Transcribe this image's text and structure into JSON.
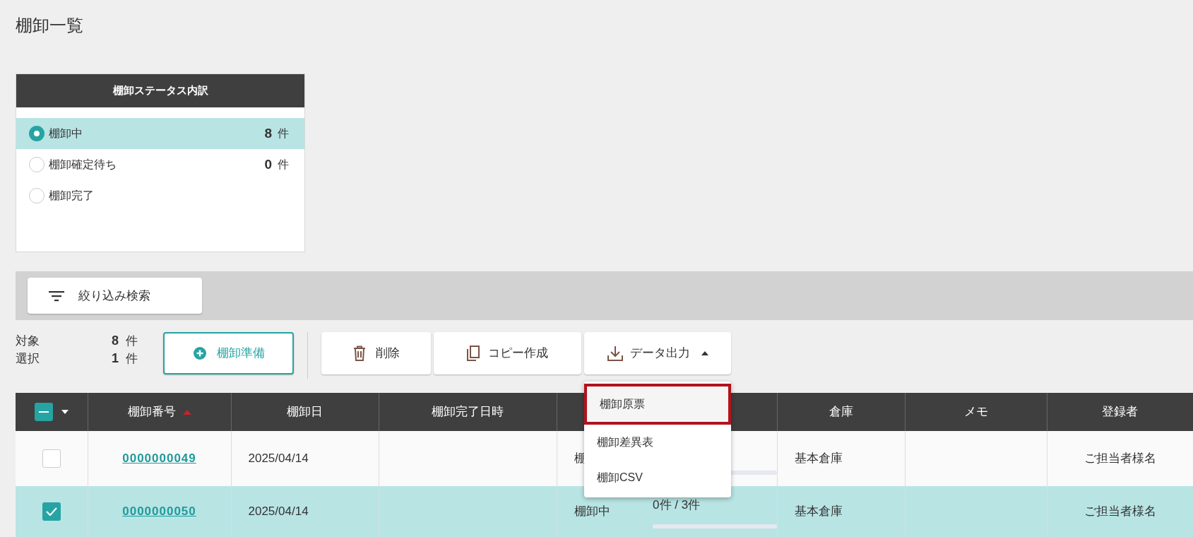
{
  "page_title": "棚卸一覧",
  "status_panel": {
    "title": "棚卸ステータス内訳",
    "items": [
      {
        "label": "棚卸中",
        "count": "8",
        "unit": "件",
        "selected": true
      },
      {
        "label": "棚卸確定待ち",
        "count": "0",
        "unit": "件",
        "selected": false
      },
      {
        "label": "棚卸完了",
        "selected": false
      }
    ]
  },
  "filter_button": "絞り込み検索",
  "summary": [
    {
      "label": "対象",
      "count": "8",
      "unit": "件"
    },
    {
      "label": "選択",
      "count": "1",
      "unit": "件"
    }
  ],
  "toolbar": [
    {
      "kind": "create",
      "label": "棚卸準備"
    },
    {
      "kind": "delete",
      "label": "削除"
    },
    {
      "kind": "copy",
      "label": "コピー作成"
    },
    {
      "kind": "export",
      "label": "データ出力",
      "expanded": true
    }
  ],
  "export_menu": [
    {
      "label": "棚卸原票",
      "selected": true
    },
    {
      "label": "棚卸差異表",
      "selected": false
    },
    {
      "label": "棚卸CSV",
      "selected": false
    }
  ],
  "table": {
    "select_all": {
      "indeterminate": true
    },
    "columns": [
      {
        "kind": "text",
        "label": "棚卸番号",
        "sort_ascending": true
      },
      {
        "kind": "text",
        "label": "棚卸日"
      },
      {
        "kind": "text",
        "label": "棚卸完了日時"
      },
      {
        "kind": "covered"
      },
      {
        "kind": "text",
        "label": "倉庫"
      },
      {
        "kind": "text",
        "label": "メモ"
      },
      {
        "kind": "text",
        "label": "登録者"
      }
    ],
    "rows": [
      {
        "selected": false,
        "number": "0000000049",
        "date": "2025/04/14",
        "status": "棚",
        "progress": {
          "level": 0
        },
        "warehouse": "基本倉庫",
        "registrant": "ご担当者様名"
      },
      {
        "selected": true,
        "number": "0000000050",
        "date": "2025/04/14",
        "status": "棚卸中",
        "progress": {
          "text": "0件 / 3件",
          "level": 0
        },
        "warehouse": "基本倉庫",
        "registrant": "ご担当者様名"
      }
    ]
  }
}
